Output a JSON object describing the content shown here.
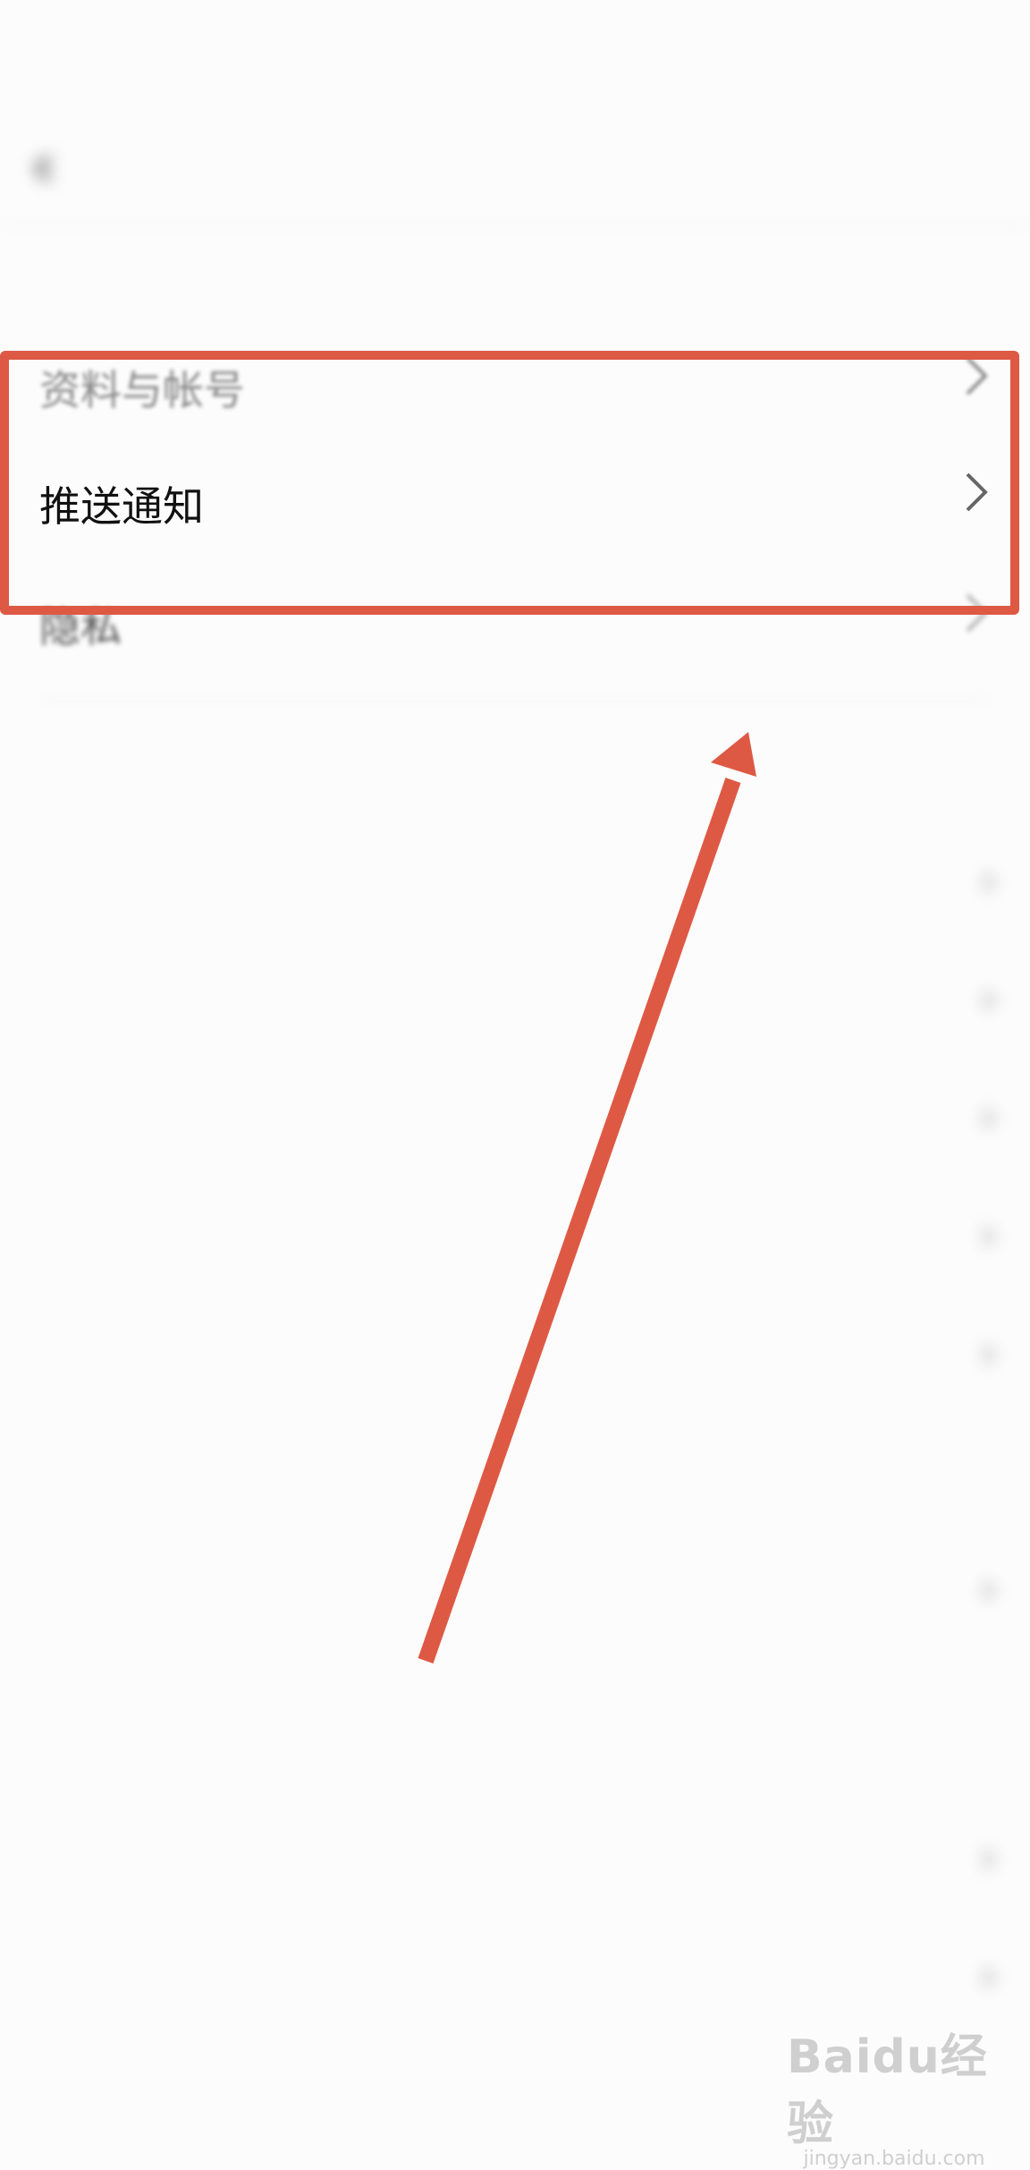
{
  "status_bar": {
    "center_text": "",
    "right_text": ""
  },
  "header": {
    "back_icon": "chevron-left-icon",
    "title": ""
  },
  "sections": [
    {
      "title": "",
      "rows": [
        {
          "label": "资料与帐号",
          "value": ""
        },
        {
          "label": "推送通知",
          "value": ""
        },
        {
          "label": "隐私",
          "value": ""
        }
      ]
    },
    {
      "title": "",
      "rows": [
        {
          "label": "",
          "value": ""
        },
        {
          "label": "",
          "value": ""
        },
        {
          "label": "",
          "value": ""
        },
        {
          "label": "",
          "value": ""
        },
        {
          "label": "",
          "value": ""
        },
        {
          "label": "",
          "value": ""
        },
        {
          "label": "",
          "value": ""
        }
      ]
    },
    {
      "title": "",
      "rows": [
        {
          "label": "",
          "value": ""
        },
        {
          "label": "",
          "value": ""
        },
        {
          "label": "",
          "value": ""
        }
      ]
    }
  ],
  "annotation": {
    "highlight_color": "#de5944"
  },
  "watermark": {
    "logo": "Baidu经验",
    "sub": "jingyan.baidu.com"
  }
}
